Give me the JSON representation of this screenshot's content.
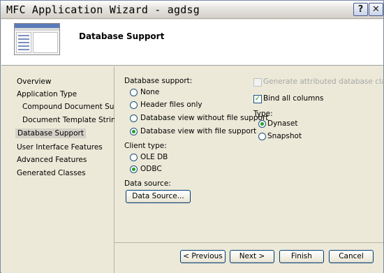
{
  "window": {
    "title": "MFC Application Wizard - agdsg",
    "help_label": "?",
    "close_label": "✕"
  },
  "header": {
    "heading": "Database Support"
  },
  "nav": {
    "items": [
      {
        "label": "Overview"
      },
      {
        "label": "Application Type"
      },
      {
        "label": "Compound Document Support"
      },
      {
        "label": "Document Template Strings"
      },
      {
        "label": "Database Support"
      },
      {
        "label": "User Interface Features"
      },
      {
        "label": "Advanced Features"
      },
      {
        "label": "Generated Classes"
      }
    ],
    "selected": "Database Support"
  },
  "database_support": {
    "label": "Database support:",
    "options": [
      {
        "label": "None"
      },
      {
        "label": "Header files only"
      },
      {
        "label": "Database view without file support"
      },
      {
        "label": "Database view with file support"
      }
    ],
    "selected": "Database view with file support"
  },
  "client_type": {
    "label": "Client type:",
    "options": [
      {
        "label": "OLE DB"
      },
      {
        "label": "ODBC"
      }
    ],
    "selected": "ODBC"
  },
  "data_source": {
    "label": "Data source:",
    "button_label": "Data Source..."
  },
  "generate_attributed": {
    "label": "Generate attributed database class",
    "checked": false,
    "enabled": false
  },
  "bind_all_columns": {
    "label": "Bind all columns",
    "checked": true
  },
  "type": {
    "label": "Type:",
    "options": [
      {
        "label": "Dynaset"
      },
      {
        "label": "Snapshot"
      }
    ],
    "selected": "Dynaset"
  },
  "footer": {
    "previous_label": "< Previous",
    "next_label": "Next >",
    "finish_label": "Finish",
    "cancel_label": "Cancel"
  }
}
